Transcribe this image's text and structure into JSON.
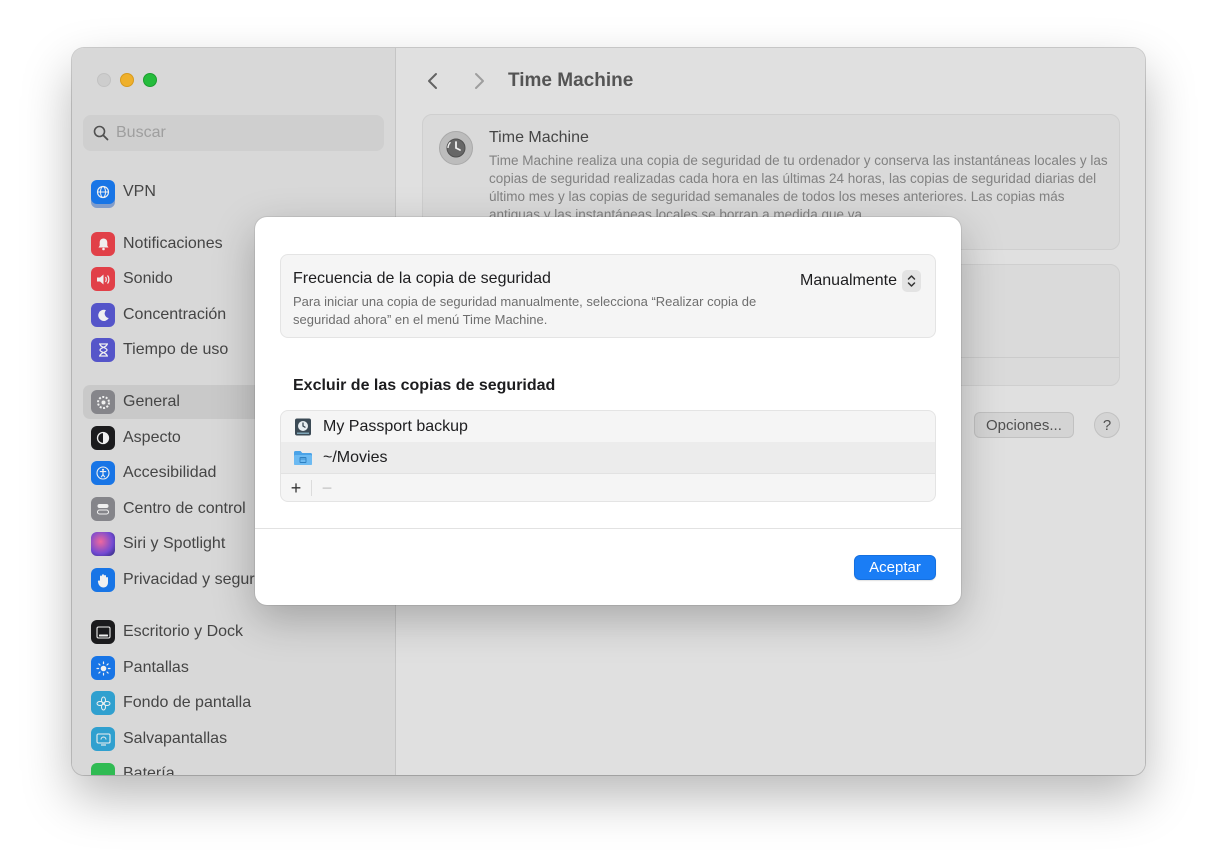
{
  "window": {
    "title": "Time Machine"
  },
  "sidebar": {
    "search_placeholder": "Buscar",
    "items": [
      {
        "label": "VPN",
        "icon": "globe-icon",
        "color": "#1a7df5"
      },
      {
        "label": "Notificaciones",
        "icon": "bell-icon",
        "color": "#f0454d"
      },
      {
        "label": "Sonido",
        "icon": "speaker-icon",
        "color": "#f0454d"
      },
      {
        "label": "Concentración",
        "icon": "moon-icon",
        "color": "#5b5bd6"
      },
      {
        "label": "Tiempo de uso",
        "icon": "hourglass-icon",
        "color": "#5b5bd6"
      },
      {
        "label": "General",
        "icon": "gear-icon",
        "color": "#8e8e93"
      },
      {
        "label": "Aspecto",
        "icon": "appearance-icon",
        "color": "#1d1d1f"
      },
      {
        "label": "Accesibilidad",
        "icon": "accessibility-icon",
        "color": "#1a7df5"
      },
      {
        "label": "Centro de control",
        "icon": "control-center-icon",
        "color": "#8e8e93"
      },
      {
        "label": "Siri y Spotlight",
        "icon": "siri-icon",
        "color": "#b04fd1"
      },
      {
        "label": "Privacidad y seguridad",
        "icon": "hand-icon",
        "color": "#1a7df5"
      },
      {
        "label": "Escritorio y Dock",
        "icon": "dock-icon",
        "color": "#1d1d1f"
      },
      {
        "label": "Pantallas",
        "icon": "sun-icon",
        "color": "#1a7df5"
      },
      {
        "label": "Fondo de pantalla",
        "icon": "flower-icon",
        "color": "#34aadc"
      },
      {
        "label": "Salvapantallas",
        "icon": "screensaver-icon",
        "color": "#34aadc"
      },
      {
        "label": "Batería",
        "icon": "battery-icon",
        "color": "#34c759"
      }
    ]
  },
  "main": {
    "title": "Time Machine",
    "card_title": "Time Machine",
    "card_description": "Time Machine realiza una copia de seguridad de tu ordenador y conserva las instantáneas locales y las copias de seguridad realizadas cada hora en las últimas 24 horas, las copias de seguridad diarias del último mes y las copias de seguridad semanales de todos los meses anteriores. Las copias más antiguas y las instantáneas locales se borran a medida que va",
    "options_label": "Opciones...",
    "help_label": "?"
  },
  "sheet": {
    "frequency_title": "Frecuencia de la copia de seguridad",
    "frequency_description": "Para iniciar una copia de seguridad manualmente, selecciona “Realizar copia de seguridad ahora” en el menú Time Machine.",
    "frequency_value": "Manualmente",
    "exclude_heading": "Excluir de las copias de seguridad",
    "exclusions": [
      {
        "label": "My Passport backup",
        "icon": "disk-icon"
      },
      {
        "label": "~/Movies",
        "icon": "folder-icon"
      }
    ],
    "add_label": "+",
    "remove_label": "−",
    "accept_label": "Aceptar",
    "accent_color": "#1a7df5"
  }
}
